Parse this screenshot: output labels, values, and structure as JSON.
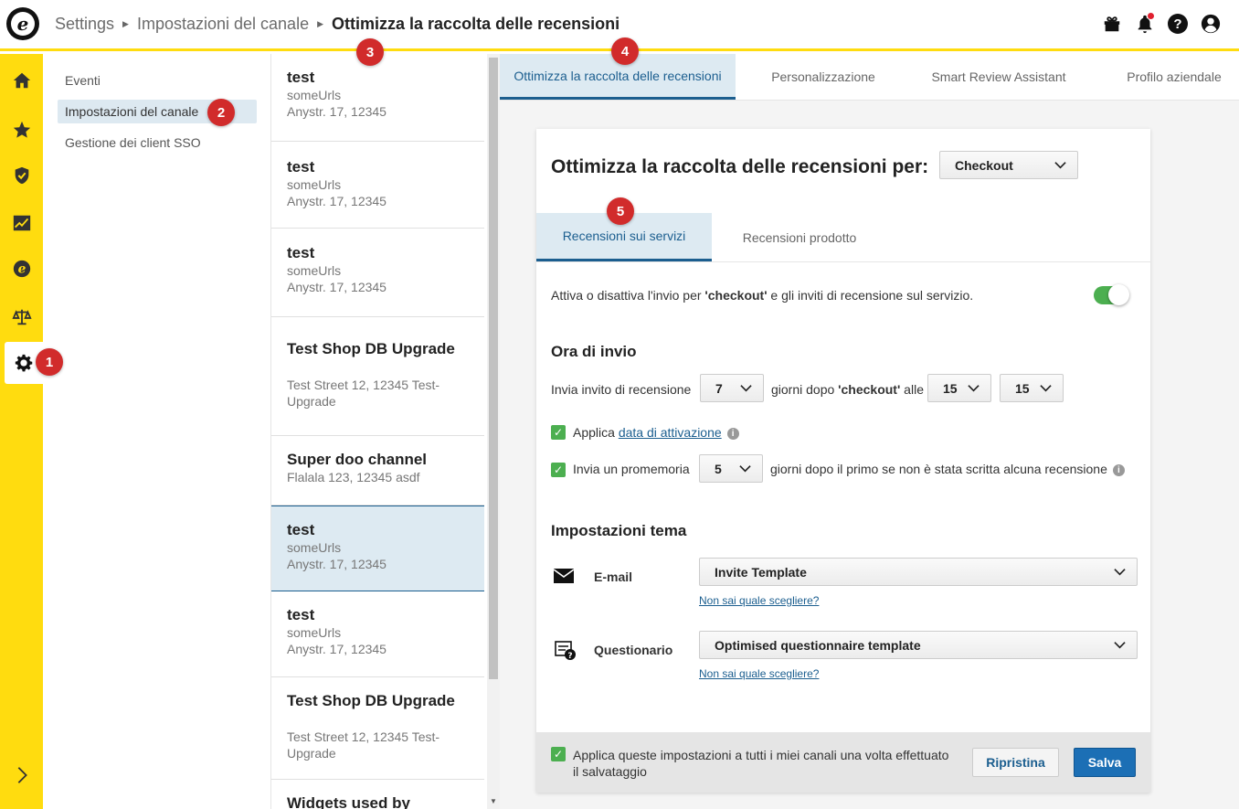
{
  "header": {
    "logo_letter": "e",
    "breadcrumb": [
      "Settings",
      "Impostazioni del canale",
      "Ottimizza la raccolta delle recensioni"
    ]
  },
  "badges": [
    "1",
    "2",
    "3",
    "4",
    "5"
  ],
  "rail": {
    "items": [
      "home-icon",
      "star-icon",
      "shield-check-icon",
      "chart-icon",
      "trusted-e-icon",
      "scales-icon",
      "gear-icon",
      "chevron-right-icon"
    ]
  },
  "subnav": {
    "items": [
      "Eventi",
      "Impostazioni del canale",
      "Gestione dei client SSO"
    ]
  },
  "channels": [
    {
      "title": "test",
      "line1": "someUrls",
      "line2": "Anystr. 17, 12345"
    },
    {
      "title": "test",
      "line1": "someUrls",
      "line2": "Anystr. 17, 12345"
    },
    {
      "title": "test",
      "line1": "someUrls",
      "line2": "Anystr. 17, 12345"
    },
    {
      "title": "Test Shop DB Upgrade",
      "line1": "Test Street 12, 12345 Test-",
      "line2": "Upgrade"
    },
    {
      "title": "Super doo channel",
      "line1": "Flalala 123, 12345 asdf",
      "line2": ""
    },
    {
      "title": "test",
      "line1": "someUrls",
      "line2": "Anystr. 17, 12345"
    },
    {
      "title": "test",
      "line1": "someUrls",
      "line2": "Anystr. 17, 12345"
    },
    {
      "title": "Test Shop DB Upgrade",
      "line1": "Test Street 12, 12345 Test-",
      "line2": "Upgrade"
    },
    {
      "title": "Widgets used by",
      "line1": "",
      "line2": ""
    }
  ],
  "tabs": [
    "Ottimizza la raccolta delle recensioni",
    "Personalizzazione",
    "Smart Review Assistant",
    "Profilo aziendale"
  ],
  "card": {
    "title": "Ottimizza la raccolta delle recensioni per:",
    "scope_select": "Checkout",
    "inner_tabs": [
      "Recensioni sui servizi",
      "Recensioni prodotto"
    ],
    "toggle_text_pre": "Attiva o disattiva l'invio per ",
    "toggle_text_bold": "'checkout'",
    "toggle_text_post": " e gli inviti di recensione sul servizio.",
    "send_time_heading": "Ora di invio",
    "send_label": "Invia invito di recensione",
    "days_value": "7",
    "days_after_pre": "giorni dopo ",
    "days_after_bold": "'checkout'",
    "days_after_post": " alle",
    "hour_value": "15",
    "minute_value": "15",
    "apply_label": "Applica ",
    "apply_link": "data di attivazione",
    "reminder_label": "Invia un promemoria",
    "reminder_value": "5",
    "reminder_text": "giorni dopo il primo se non è stata scritta alcuna recensione",
    "theme_heading": "Impostazioni tema",
    "email_label": "E-mail",
    "email_template": "Invite Template",
    "help_link": "Non sai quale scegliere?",
    "questionnaire_label": "Questionario",
    "questionnaire_template": "Optimised questionnaire template",
    "footer_checkbox_line1": "Applica queste impostazioni a tutti i miei canali una volta effettuato",
    "footer_checkbox_line2": "il salvataggio",
    "reset_button": "Ripristina",
    "save_button": "Salva"
  },
  "colors": {
    "accent_yellow": "#ffdc0f",
    "primary_blue": "#1c6fb5",
    "badge_red": "#d12b2b",
    "toggle_green": "#4caf50"
  }
}
